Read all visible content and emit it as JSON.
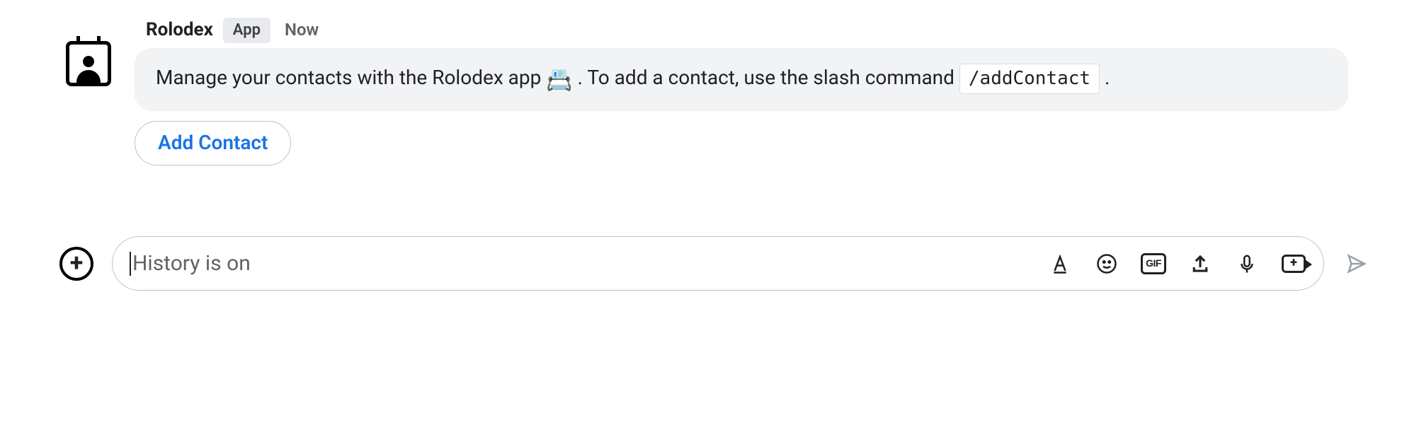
{
  "message": {
    "sender_name": "Rolodex",
    "sender_badge": "App",
    "timestamp": "Now",
    "body_prefix": "Manage your contacts with the Rolodex app ",
    "body_mid": ". To add a contact, use the slash command ",
    "slash_command": "/addContact",
    "body_suffix": ".",
    "emoji": "📇",
    "action_button": "Add Contact"
  },
  "composer": {
    "placeholder": "History is on",
    "gif_label": "GIF",
    "video_plus": "+"
  }
}
